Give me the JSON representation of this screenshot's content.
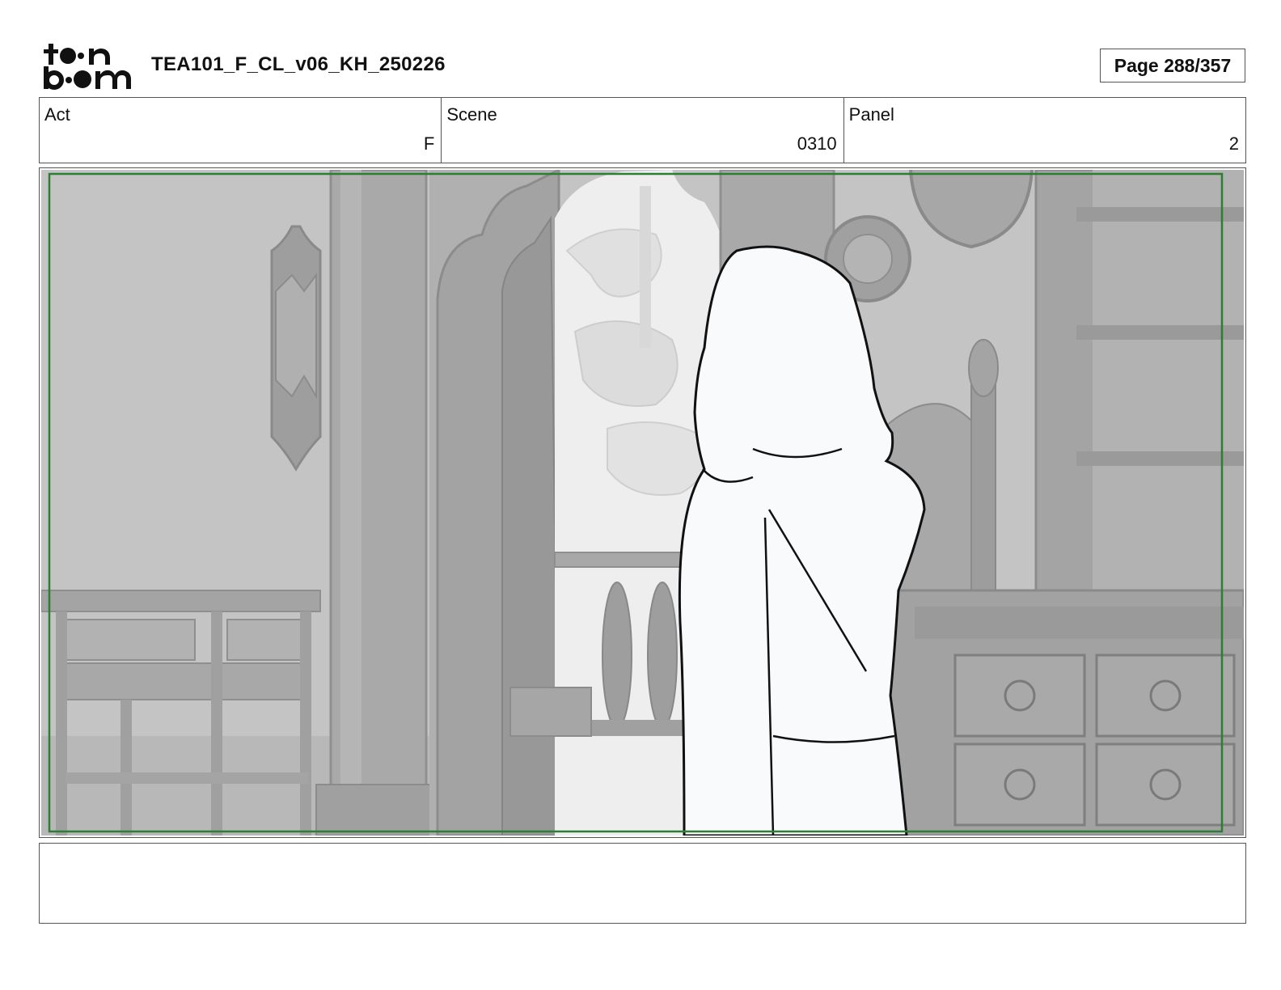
{
  "header": {
    "logo_text": "toonboom",
    "document_title": "TEA101_F_CL_v06_KH_250226",
    "page_indicator": "Page 288/357"
  },
  "info": {
    "act": {
      "label": "Act",
      "value": "F"
    },
    "scene": {
      "label": "Scene",
      "value": "0310"
    },
    "panel": {
      "label": "Panel",
      "value": "2"
    }
  },
  "panel_image": {
    "description_icon": "storyboard-drawing",
    "safe_frame_color": "#2e7d32"
  },
  "notes": {
    "text": ""
  }
}
